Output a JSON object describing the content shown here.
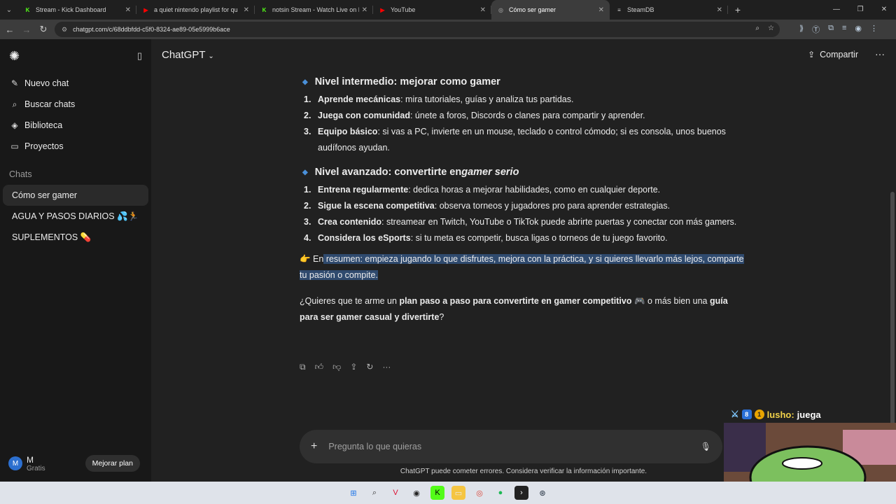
{
  "browser": {
    "tabs": [
      {
        "title": "Stream - Kick Dashboard",
        "fav_color": "#53fc18",
        "fav_glyph": "K",
        "active": false
      },
      {
        "title": "a quiet nintendo playlist for qu",
        "fav_color": "#ff0000",
        "fav_glyph": "▶",
        "active": false
      },
      {
        "title": "notsin Stream - Watch Live on K",
        "fav_color": "#53fc18",
        "fav_glyph": "K",
        "active": false
      },
      {
        "title": "YouTube",
        "fav_color": "#ff0000",
        "fav_glyph": "▶",
        "active": false
      },
      {
        "title": "Cómo ser gamer",
        "fav_color": "#888888",
        "fav_glyph": "◎",
        "active": true
      },
      {
        "title": "SteamDB",
        "fav_color": "#cccccc",
        "fav_glyph": "≡",
        "active": false
      }
    ],
    "url": "chatgpt.com/c/68ddbfdd-c5f0-8324-ae89-05e5999b6ace"
  },
  "sidebar": {
    "menu": [
      {
        "icon": "edit-icon",
        "glyph": "✎",
        "label": "Nuevo chat"
      },
      {
        "icon": "search-icon",
        "glyph": "⌕",
        "label": "Buscar chats"
      },
      {
        "icon": "library-icon",
        "glyph": "◈",
        "label": "Biblioteca"
      },
      {
        "icon": "folder-icon",
        "glyph": "▭",
        "label": "Proyectos"
      }
    ],
    "section_title": "Chats",
    "chats": [
      {
        "label": "Cómo ser gamer",
        "active": true
      },
      {
        "label": "AGUA Y PASOS DIARIOS 💦🏃",
        "active": false
      },
      {
        "label": "SUPLEMENTOS 💊",
        "active": false
      }
    ],
    "user": {
      "initial": "M",
      "name": "M",
      "plan": "Gratis",
      "upgrade_label": "Mejorar plan"
    }
  },
  "header": {
    "model": "ChatGPT",
    "share_label": "Compartir"
  },
  "message": {
    "section_mid": {
      "title": "Nivel intermedio: mejorar como gamer",
      "items": [
        {
          "num": "1.",
          "bold": "Aprende mecánicas",
          "text": ": mira tutoriales, guías y analiza tus partidas."
        },
        {
          "num": "2.",
          "bold": "Juega con comunidad",
          "text": ": únete a foros, Discords o clanes para compartir y aprender."
        },
        {
          "num": "3.",
          "bold": "Equipo básico",
          "text": ": si vas a PC, invierte en un mouse, teclado o control cómodo; si es consola, unos buenos audífonos ayudan."
        }
      ]
    },
    "section_adv": {
      "title_prefix": "Nivel avanzado: convertirte en ",
      "title_italic": "gamer serio",
      "items": [
        {
          "num": "1.",
          "bold": "Entrena regularmente",
          "text": ": dedica horas a mejorar habilidades, como en cualquier deporte."
        },
        {
          "num": "2.",
          "bold": "Sigue la escena competitiva",
          "text": ": observa torneos y jugadores pro para aprender estrategias."
        },
        {
          "num": "3.",
          "bold": "Crea contenido",
          "text": ": streamear en Twitch, YouTube o TikTok puede abrirte puertas y conectar con más gamers."
        },
        {
          "num": "4.",
          "bold": "Considera los eSports",
          "text": ": si tu meta es competir, busca ligas o torneos de tu juego favorito."
        }
      ]
    },
    "summary_emoji": "👉",
    "summary_start": " En",
    "summary_selected": " resumen: empieza jugando lo que disfrutes, mejora con la práctica, y si quieres llevarlo más lejos, comparte tu pasión o compite.",
    "question_a": "¿Quieres que te arme un ",
    "question_b": "plan paso a paso para convertirte en gamer competitivo",
    "question_c": " 🎮 o más bien una ",
    "question_d": "guía para ser gamer casual y divertirte",
    "question_e": "?"
  },
  "composer": {
    "placeholder": "Pregunta lo que quieras"
  },
  "disclaimer": "ChatGPT puede cometer errores. Considera verificar la información importante.",
  "stream_overlay": {
    "user": "lusho:",
    "message": "juega"
  }
}
